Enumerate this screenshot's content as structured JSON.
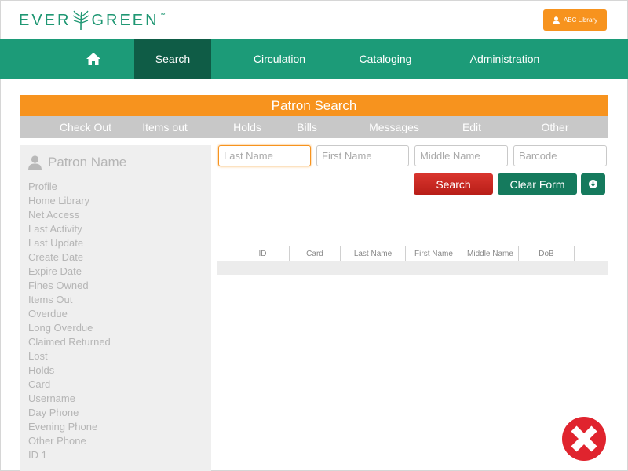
{
  "header": {
    "logo_left": "EVER",
    "logo_right": "GREEN",
    "logo_tm": "™",
    "library_button": "ABC Library"
  },
  "nav": {
    "home_icon": "home-icon",
    "items": [
      "Search",
      "Circulation",
      "Cataloging",
      "Administration"
    ],
    "active": "Search"
  },
  "patron_search": {
    "title": "Patron Search",
    "tabs": [
      "Check Out",
      "Items out",
      "Holds",
      "Bills",
      "Messages",
      "Edit",
      "Other"
    ]
  },
  "patron_panel": {
    "name": "Patron Name",
    "fields": [
      "Profile",
      "Home Library",
      "Net Access",
      "Last Activity",
      "Last Update",
      "Create Date",
      "Expire Date",
      "Fines Owned",
      "Items Out",
      "Overdue",
      "Long Overdue",
      "Claimed Returned",
      "Lost",
      "Holds",
      "Card",
      "Username",
      "Day Phone",
      "Evening Phone",
      "Other Phone",
      "ID 1"
    ]
  },
  "search_form": {
    "last_name": {
      "placeholder": "Last Name",
      "value": ""
    },
    "first_name": {
      "placeholder": "First Name",
      "value": ""
    },
    "middle_name": {
      "placeholder": "Middle Name",
      "value": ""
    },
    "barcode": {
      "placeholder": "Barcode",
      "value": ""
    },
    "search_button": "Search",
    "clear_button": "Clear Form"
  },
  "results": {
    "columns": [
      "",
      "ID",
      "Card",
      "Last Name",
      "First Name",
      "Middle Name",
      "DoB",
      ""
    ]
  },
  "colors": {
    "brand_green": "#1c9b78",
    "active_nav": "#0f5c46",
    "orange": "#f7931e",
    "search_red": "#c8281f",
    "close_red": "#e0242e"
  }
}
